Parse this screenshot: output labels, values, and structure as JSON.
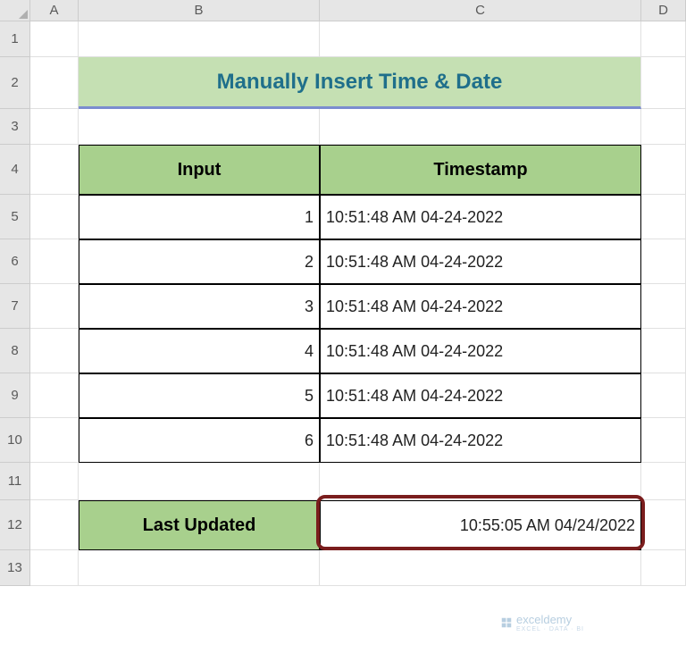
{
  "columns": {
    "A": "A",
    "B": "B",
    "C": "C",
    "D": "D"
  },
  "rowNums": {
    "1": "1",
    "2": "2",
    "3": "3",
    "4": "4",
    "5": "5",
    "6": "6",
    "7": "7",
    "8": "8",
    "9": "9",
    "10": "10",
    "11": "11",
    "12": "12",
    "13": "13"
  },
  "title": "Manually Insert Time & Date",
  "headers": {
    "input": "Input",
    "timestamp": "Timestamp"
  },
  "rows": [
    {
      "input": "1",
      "timestamp": "10:51:48 AM 04-24-2022"
    },
    {
      "input": "2",
      "timestamp": "10:51:48 AM 04-24-2022"
    },
    {
      "input": "3",
      "timestamp": "10:51:48 AM 04-24-2022"
    },
    {
      "input": "4",
      "timestamp": "10:51:48 AM 04-24-2022"
    },
    {
      "input": "5",
      "timestamp": "10:51:48 AM 04-24-2022"
    },
    {
      "input": "6",
      "timestamp": "10:51:48 AM 04-24-2022"
    }
  ],
  "lastUpdated": {
    "label": "Last Updated",
    "value": "10:55:05 AM 04/24/2022"
  },
  "watermark": {
    "name": "exceldemy",
    "tagline": "EXCEL · DATA · BI"
  }
}
